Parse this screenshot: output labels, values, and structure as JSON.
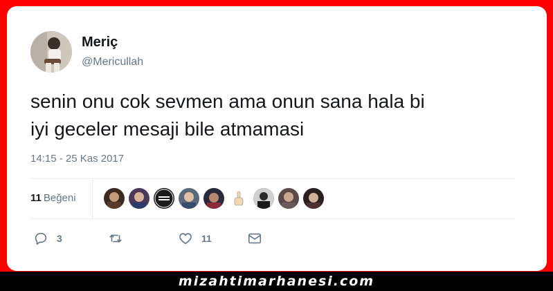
{
  "tweet": {
    "author_name": "Meriç",
    "author_handle": "@Mericullah",
    "text_lines": [
      "senin onu cok sevmen ama onun sana hala bi",
      "iyi geceler mesaji bile atmamasi"
    ],
    "timestamp": "14:15 - 25 Kas 2017"
  },
  "likes": {
    "count": "11",
    "label": "Beğeni",
    "likers": [
      {
        "name": "liker-avatar-1",
        "color": "#3a2a20"
      },
      {
        "name": "liker-avatar-2",
        "color": "#4a3a5a"
      },
      {
        "name": "liker-avatar-3",
        "color": "#1a1a1a"
      },
      {
        "name": "liker-avatar-4",
        "color": "#5a6a7a"
      },
      {
        "name": "liker-avatar-5",
        "color": "#2a2a3a"
      },
      {
        "name": "liker-avatar-6",
        "color": "#ffffff"
      },
      {
        "name": "liker-avatar-7",
        "color": "#3a3a3a"
      },
      {
        "name": "liker-avatar-8",
        "color": "#5a4a4a"
      },
      {
        "name": "liker-avatar-9",
        "color": "#2a2020"
      }
    ]
  },
  "actions": {
    "reply": {
      "icon": "reply-icon",
      "count": "3"
    },
    "retweet": {
      "icon": "retweet-icon",
      "count": ""
    },
    "like": {
      "icon": "heart-icon",
      "count": "11"
    },
    "message": {
      "icon": "envelope-icon",
      "count": ""
    }
  },
  "watermark": "mizahtimarhanesi.com",
  "colors": {
    "frame": "#ff0000",
    "card": "#ffffff",
    "secondary_text": "#657786",
    "primary_text": "#14171a",
    "divider": "#e6ecf0"
  }
}
